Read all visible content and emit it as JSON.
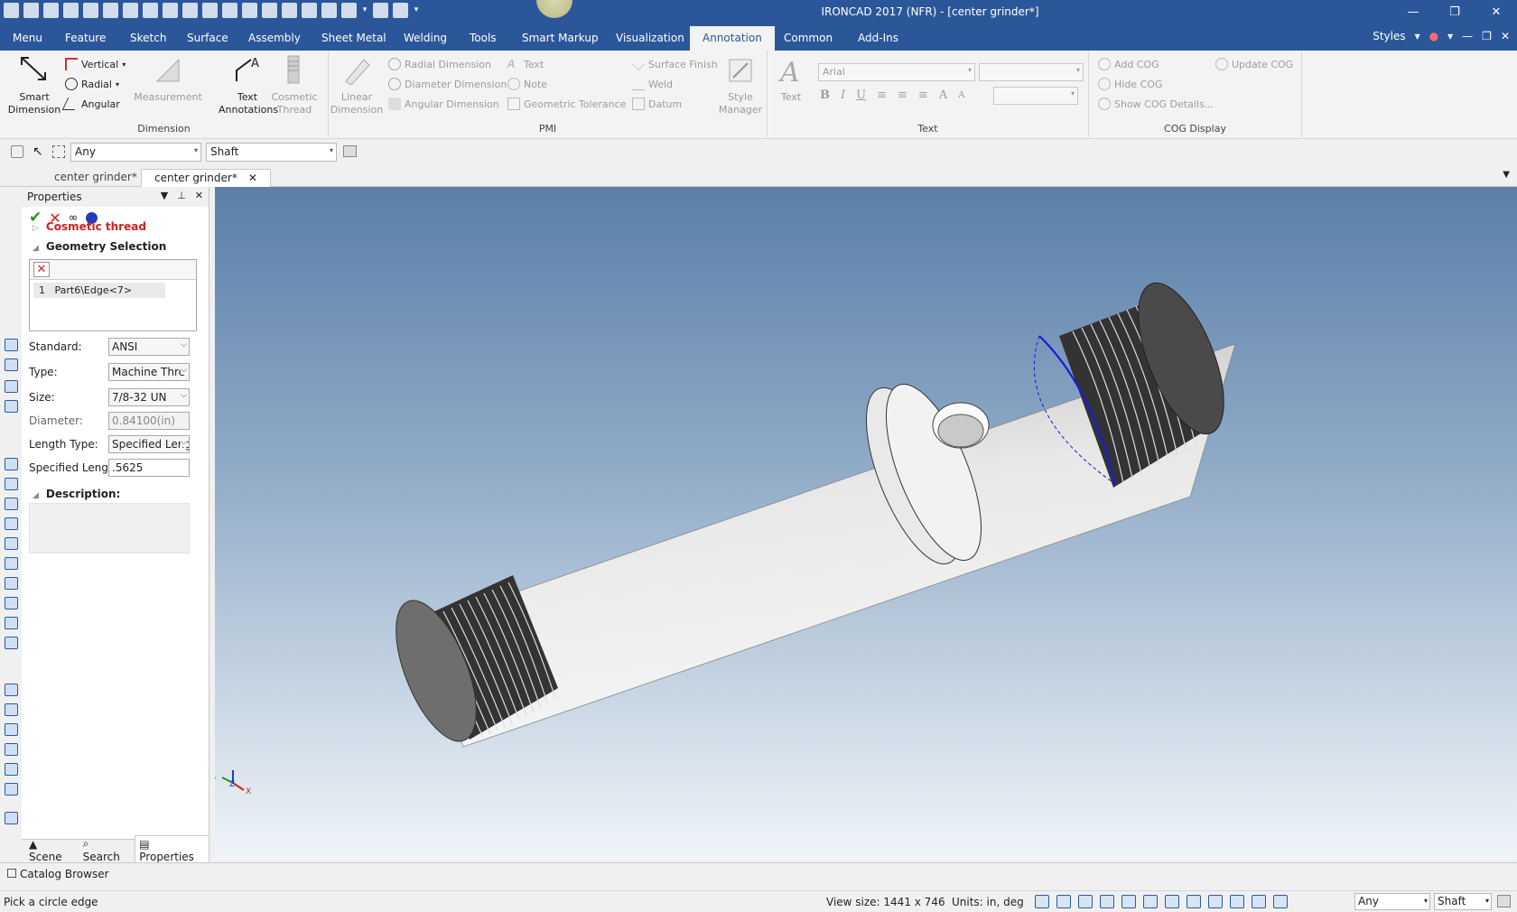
{
  "window": {
    "title": "IRONCAD 2017 (NFR) - [center grinder*]",
    "controls": [
      "—",
      "❐",
      "✕"
    ]
  },
  "menu": {
    "tabs": [
      "Menu",
      "Feature",
      "Sketch",
      "Surface",
      "Assembly",
      "Sheet Metal",
      "Welding",
      "Tools",
      "Smart Markup",
      "Visualization",
      "Annotation",
      "Common",
      "Add-Ins"
    ],
    "active_tab": "Annotation",
    "styles_label": "Styles"
  },
  "ribbon": {
    "dimension": {
      "group_label": "Dimension",
      "smart_dimension": [
        "Smart",
        "Dimension"
      ],
      "vertical": "Vertical",
      "radial": "Radial",
      "angular": "Angular",
      "measurement": "Measurement",
      "text_annotations": [
        "Text",
        "Annotations"
      ],
      "cosmetic_thread": [
        "Cosmetic",
        "Thread"
      ]
    },
    "pmi": {
      "group_label": "PMI",
      "linear_dimension": [
        "Linear",
        "Dimension"
      ],
      "radial_dimension": "Radial Dimension",
      "diameter_dimension": "Diameter Dimension",
      "angular_dimension": "Angular Dimension",
      "text": "Text",
      "note": "Note",
      "geometric_tolerance": "Geometric Tolerance",
      "surface_finish": "Surface Finish",
      "weld": "Weld",
      "datum": "Datum",
      "style_manager": [
        "Style",
        "Manager"
      ]
    },
    "text": {
      "group_label": "Text",
      "text_btn": "Text",
      "font": "Arial"
    },
    "cog": {
      "group_label": "COG Display",
      "add_cog": "Add COG",
      "hide_cog": "Hide COG",
      "show_cog_details": "Show COG Details...",
      "update_cog": "Update COG"
    }
  },
  "selection_toolbar": {
    "filter": "Any",
    "level": "Shaft"
  },
  "doc_tabs": [
    {
      "label": "center grinder*",
      "active": false
    },
    {
      "label": "center grinder*",
      "active": true
    }
  ],
  "properties": {
    "title": "Properties",
    "cosmetic_thread_label": "Cosmetic thread",
    "geometry_selection_label": "Geometry Selection",
    "geometry_rows": [
      {
        "index": "1",
        "name": "Part6\\Edge<7>"
      }
    ],
    "fields": {
      "standard": {
        "label": "Standard:",
        "value": "ANSI"
      },
      "type": {
        "label": "Type:",
        "value": "Machine Thre"
      },
      "size": {
        "label": "Size:",
        "value": "7/8-32 UN"
      },
      "diameter": {
        "label": "Diameter:",
        "value": "0.84100(in)"
      },
      "length_type": {
        "label": "Length Type:",
        "value": "Specified Leng"
      },
      "specified_length": {
        "label": "Specified Length",
        "value": ".5625"
      }
    },
    "description_label": "Description:",
    "bottom_tabs": [
      "Scene",
      "Search",
      "Properties"
    ]
  },
  "catalog_label": "Catalog Browser",
  "status": {
    "message": "Pick a circle edge",
    "view_size": "View size: 1441 x  746",
    "units": "Units: in, deg",
    "filter": "Any",
    "level": "Shaft"
  },
  "colors": {
    "title_bar": "#2b579a",
    "selection_edge": "#1b1bd6",
    "viewport_top": "#5b7fa8",
    "viewport_bottom": "#f0f4f8"
  }
}
